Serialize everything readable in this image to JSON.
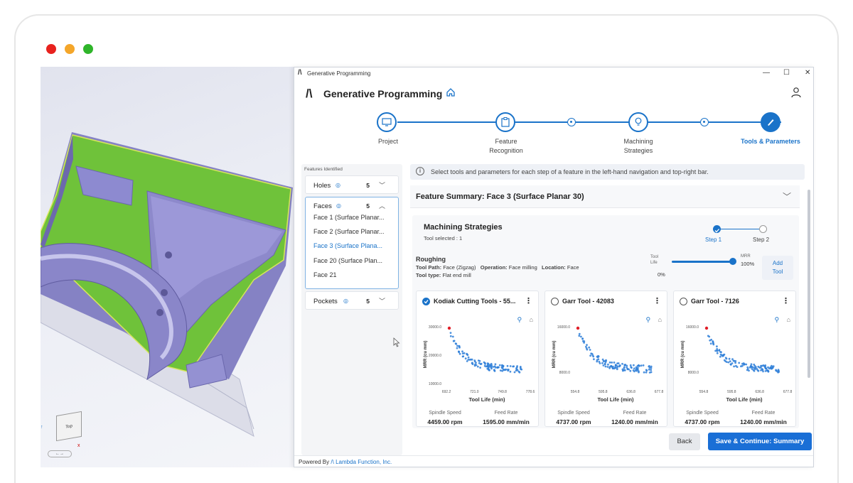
{
  "window": {
    "title": "Generative Programming",
    "controls": [
      "minimize",
      "maximize",
      "close"
    ],
    "traffic_lights": [
      "#e8221e",
      "#f4a62a",
      "#2fb52a"
    ]
  },
  "header": {
    "logo_glyph": "/\\",
    "title": "Generative Programming",
    "home_icon": "home-icon",
    "user_icon": "user-icon"
  },
  "stepper": {
    "steps": [
      {
        "label": "Project",
        "state": "done",
        "icon": "monitor-icon"
      },
      {
        "label": "Feature\nRecognition",
        "state": "done",
        "icon": "clipboard-icon"
      },
      {
        "label": "Machining\nStrategies",
        "state": "done",
        "icon": "lightbulb-icon"
      },
      {
        "label": "Tools & Parameters",
        "state": "active",
        "icon": "brush-icon"
      }
    ]
  },
  "sidebar": {
    "header": "Features Identified",
    "groups": [
      {
        "name": "Holes",
        "count": "5",
        "expanded": false
      },
      {
        "name": "Faces",
        "count": "5",
        "expanded": true,
        "items": [
          "Face 1 (Surface Planar...",
          "Face 2 (Surface Planar...",
          "Face 3 (Surface Plana...",
          "Face 20 (Surface Plan...",
          "Face 21"
        ],
        "selected_index": 2
      },
      {
        "name": "Pockets",
        "count": "5",
        "expanded": false
      }
    ]
  },
  "info_bar": {
    "text": "Select tools and parameters for each step of a feature in the left-hand navigation and top-right bar."
  },
  "feature_summary": {
    "title": "Feature Summary: Face 3 (Surface Planar 30)"
  },
  "machining": {
    "title": "Machining Strategies",
    "tool_selected": "Tool selected : 1",
    "steps": [
      "Step 1",
      "Step 2"
    ],
    "roughing": {
      "heading": "Roughing",
      "tool_path_label": "Tool Path:",
      "tool_path": "Face (Zigzag)",
      "operation_label": "Operation:",
      "operation": "Face milling",
      "location_label": "Location:",
      "location": "Face",
      "tool_type_label": "Tool type:",
      "tool_type": "Flat end mill"
    },
    "slider": {
      "left_label": "Tool\nLife",
      "left_value": "0%",
      "right_label": "MRR",
      "right_value": "100%",
      "value": 1.0
    },
    "add_tool": "Add\nTool"
  },
  "cards": [
    {
      "name": "Kodiak Cutting Tools - 55...",
      "selected": true,
      "chart": {
        "y_ticks": [
          "30000.0",
          "20000.0",
          "10000.0"
        ],
        "x_ticks": [
          "692.2",
          "721.0",
          "749.8",
          "778.6"
        ],
        "xlabel": "Tool Life (min)",
        "ylabel": "MRR (cu mm)"
      },
      "spindle_label": "Spindle Speed",
      "spindle": "4459.00 rpm",
      "feed_label": "Feed Rate",
      "feed": "1595.00 mm/min"
    },
    {
      "name": "Garr Tool - 42083",
      "selected": false,
      "chart": {
        "y_ticks": [
          "16000.0",
          "8000.0"
        ],
        "x_ticks": [
          "554.8",
          "595.8",
          "636.8",
          "677.8"
        ],
        "xlabel": "Tool Life (min)",
        "ylabel": "MRR (cu mm)"
      },
      "spindle_label": "Spindle Speed",
      "spindle": "4737.00 rpm",
      "feed_label": "Feed Rate",
      "feed": "1240.00 mm/min"
    },
    {
      "name": "Garr Tool - 7126",
      "selected": false,
      "chart": {
        "y_ticks": [
          "16000.0",
          "8000.0"
        ],
        "x_ticks": [
          "554.8",
          "595.8",
          "636.8",
          "677.8"
        ],
        "xlabel": "Tool Life (min)",
        "ylabel": "MRR (cu mm)"
      },
      "spindle_label": "Spindle Speed",
      "spindle": "4737.00 rpm",
      "feed_label": "Feed Rate",
      "feed": "1240.00 mm/min"
    }
  ],
  "buttons": {
    "back": "Back",
    "save": "Save & Continue: Summary"
  },
  "footer": {
    "powered_by": "Powered By",
    "company": "Lambda Function, Inc."
  },
  "viewcube": {
    "label": "Top"
  },
  "colors": {
    "accent": "#1a73c9",
    "face_green": "#6fc23a",
    "part_purple": "#8c88c9",
    "scatter_blue": "#2f7fd8",
    "highlight_red": "#e01e28"
  }
}
